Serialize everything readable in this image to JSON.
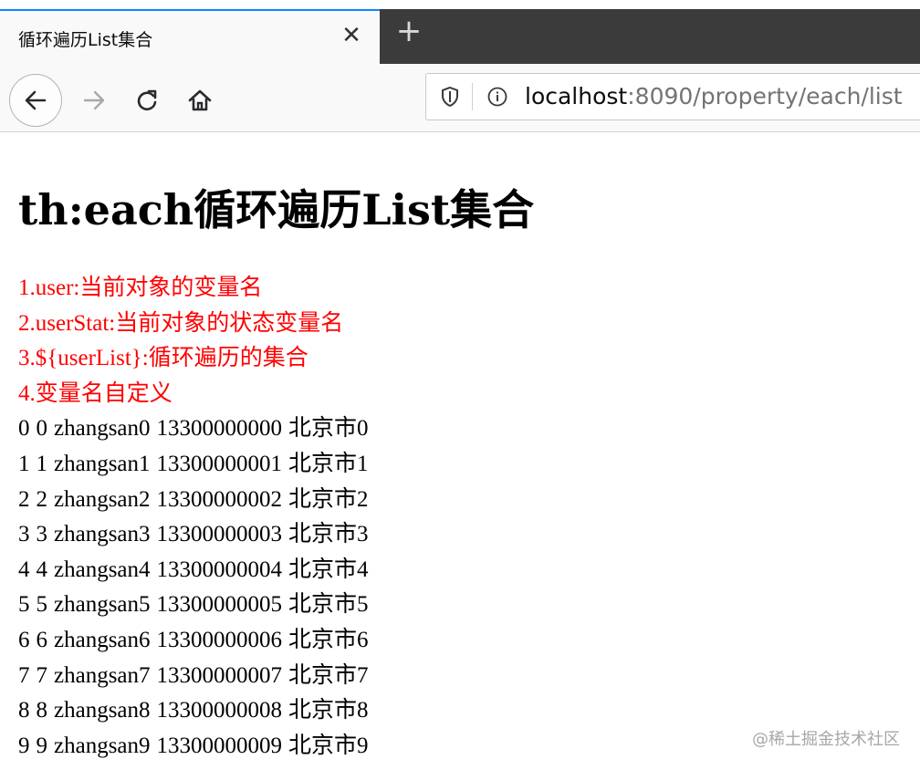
{
  "browser": {
    "tab": {
      "title": "循环遍历List集合",
      "close_icon": "close-icon"
    },
    "new_tab_icon": "plus-icon",
    "url": {
      "host": "localhost",
      "rest": ":8090/property/each/list"
    },
    "colors": {
      "tab_accent": "#0a84ff",
      "tabstrip_bg": "#3b3b3b"
    }
  },
  "page": {
    "title": "th:each循环遍历List集合",
    "notes": [
      "1.user:当前对象的变量名",
      "2.userStat:当前对象的状态变量名",
      "3.${userList}:循环遍历的集合",
      "4.变量名自定义"
    ],
    "note_color": "#ff0000",
    "rows": [
      {
        "index": "0",
        "id": "0",
        "name": "zhangsan0",
        "phone": "13300000000",
        "address": "北京市0"
      },
      {
        "index": "1",
        "id": "1",
        "name": "zhangsan1",
        "phone": "13300000001",
        "address": "北京市1"
      },
      {
        "index": "2",
        "id": "2",
        "name": "zhangsan2",
        "phone": "13300000002",
        "address": "北京市2"
      },
      {
        "index": "3",
        "id": "3",
        "name": "zhangsan3",
        "phone": "13300000003",
        "address": "北京市3"
      },
      {
        "index": "4",
        "id": "4",
        "name": "zhangsan4",
        "phone": "13300000004",
        "address": "北京市4"
      },
      {
        "index": "5",
        "id": "5",
        "name": "zhangsan5",
        "phone": "13300000005",
        "address": "北京市5"
      },
      {
        "index": "6",
        "id": "6",
        "name": "zhangsan6",
        "phone": "13300000006",
        "address": "北京市6"
      },
      {
        "index": "7",
        "id": "7",
        "name": "zhangsan7",
        "phone": "13300000007",
        "address": "北京市7"
      },
      {
        "index": "8",
        "id": "8",
        "name": "zhangsan8",
        "phone": "13300000008",
        "address": "北京市8"
      },
      {
        "index": "9",
        "id": "9",
        "name": "zhangsan9",
        "phone": "13300000009",
        "address": "北京市9"
      }
    ]
  },
  "watermark": "@稀土掘金技术社区"
}
